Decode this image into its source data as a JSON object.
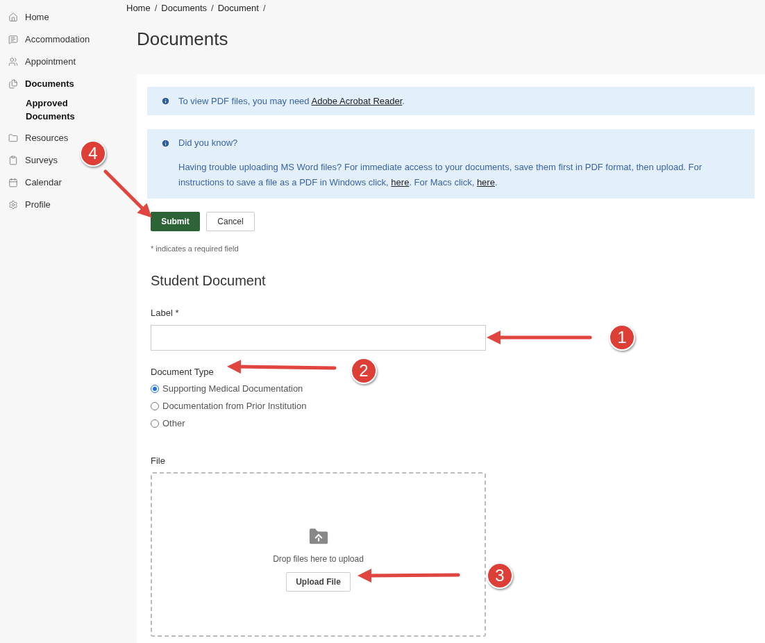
{
  "sidebar": {
    "items": [
      {
        "label": "Home",
        "selected": false
      },
      {
        "label": "Accommodation",
        "selected": false
      },
      {
        "label": "Appointment",
        "selected": false
      },
      {
        "label": "Documents",
        "selected": true,
        "children": [
          {
            "label": "Approved Documents",
            "selected": true
          }
        ]
      },
      {
        "label": "Resources",
        "selected": false
      },
      {
        "label": "Surveys",
        "selected": false
      },
      {
        "label": "Calendar",
        "selected": false
      },
      {
        "label": "Profile",
        "selected": false
      }
    ]
  },
  "breadcrumb": {
    "items": [
      "Home",
      "Documents",
      "Document"
    ],
    "separator": "/"
  },
  "page_title": "Documents",
  "notices": [
    {
      "text": "To view PDF files, you may need ",
      "link": "Adobe Acrobat Reader",
      "after": "."
    },
    {
      "title": "Did you know?",
      "body_start": "Having trouble uploading MS Word files? For immediate access to your documents, save them first in PDF format, then upload. For instructions to save a file as a PDF in Windows click, ",
      "link_1": "here",
      "middle": ". For Macs click, ",
      "link_2": "here",
      "after": "."
    }
  ],
  "buttons": {
    "submit": "Submit",
    "cancel": "Cancel"
  },
  "required_note": "* indicates a required field",
  "section_title": "Student Document",
  "label_field": {
    "label": "Label *"
  },
  "document_type": {
    "label": "Document Type",
    "options": [
      {
        "label": "Supporting Medical Documentation",
        "selected": true
      },
      {
        "label": "Documentation from Prior Institution",
        "selected": false
      },
      {
        "label": "Other",
        "selected": false
      }
    ]
  },
  "file": {
    "label": "File",
    "hint": "Drop files here to upload",
    "button": "Upload File"
  },
  "callouts": [
    "1",
    "2",
    "3",
    "4"
  ]
}
